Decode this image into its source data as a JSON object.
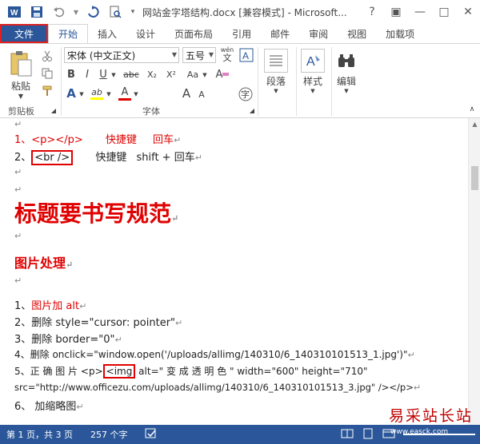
{
  "window": {
    "title": "网站金字塔结构.docx [兼容模式] - Microsoft...",
    "help": "?",
    "restore": "▣",
    "minimize": "—",
    "maximize": "□",
    "close": "✕"
  },
  "tabs": {
    "file": "文件",
    "items": [
      "开始",
      "插入",
      "设计",
      "页面布局",
      "引用",
      "邮件",
      "审阅",
      "视图",
      "加载项"
    ]
  },
  "ribbon": {
    "paste": "粘贴",
    "font_name": "宋体 (中文正文)",
    "font_size": "五号",
    "wen": "wén",
    "wen_char": "文",
    "bold": "B",
    "italic": "I",
    "underline": "U",
    "strike": "abc",
    "subscript": "X₂",
    "superscript": "X²",
    "text_effects": "A",
    "highlight": "ab",
    "font_color": "A",
    "grow": "A",
    "shrink": "A",
    "aa": "Aa",
    "clear": "A",
    "phonetic": "字",
    "paragraph": "段落",
    "styles": "样式",
    "editing": "编辑",
    "groups": {
      "clipboard": "剪贴板",
      "font": "字体"
    }
  },
  "document": {
    "l1_prefix": "1、",
    "l1_code": "<p></p>",
    "l1_shortcut": "快捷键",
    "l1_key": "回车",
    "l2_prefix": "2、",
    "l2_code": "<br />",
    "l2_shortcut": "快捷键",
    "l2_key": "shift + 回车",
    "heading": "标题要书写规范",
    "subheading": "图片处理",
    "items": [
      {
        "n": "1、",
        "text": "图片加 alt"
      },
      {
        "n": "2、",
        "text": "删除 style=\"cursor: pointer\""
      },
      {
        "n": "3、",
        "text": "删除 border=\"0\""
      },
      {
        "n": "4、",
        "text": "删除 onclick=\"window.open('/uploads/allimg/140310/6_140310101513_1.jpg')\""
      }
    ],
    "item5_n": "5、",
    "item5_a": "正 确 图 片 <p>",
    "item5_code": "<img",
    "item5_b": "alt=\" 变 成 透 明 色 \"  width=\"600\"  height=\"710\"",
    "item5_c": "src=\"http://www.officezu.com/uploads/allimg/140310/6_140310101513_3.jpg\" /></p>",
    "item6": "6、 加缩略图"
  },
  "status": {
    "page": "第 1 页，共 3 页",
    "words": "257 个字"
  },
  "watermark": {
    "text": "易采站长站",
    "url": "www.easck.com"
  }
}
